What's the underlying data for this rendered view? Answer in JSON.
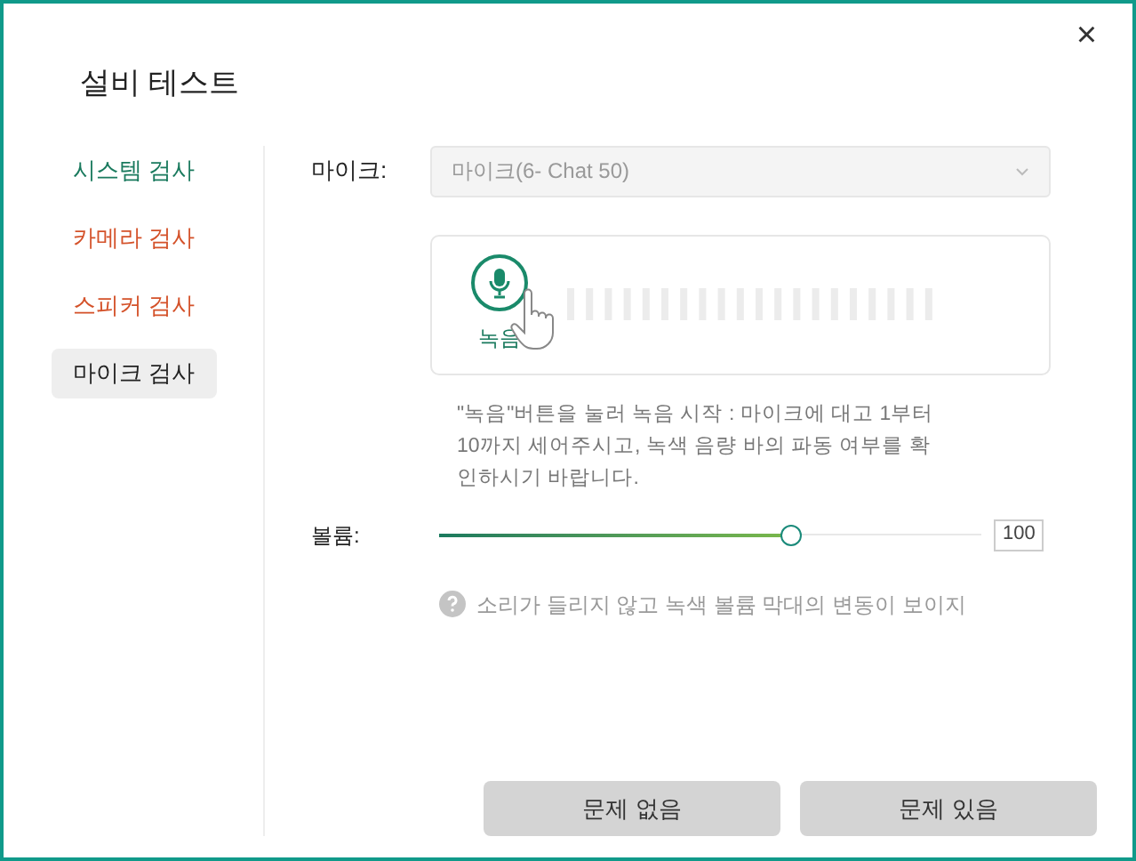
{
  "window": {
    "title": "설비 테스트",
    "close": "×"
  },
  "sidebar": {
    "items": [
      {
        "label": "시스템 검사",
        "selected": false,
        "color": "#1a7a5e"
      },
      {
        "label": "카메라 검사",
        "selected": false,
        "color": "#d4522a"
      },
      {
        "label": "스피커 검사",
        "selected": false,
        "color": "#d4522a"
      },
      {
        "label": "마이크 검사",
        "selected": true,
        "color": "#222222"
      }
    ]
  },
  "microphone": {
    "label": "마이크:",
    "value": "마이크(6- Chat 50)",
    "disabled": true
  },
  "recorder": {
    "button_label": "녹음"
  },
  "instructions": "\"녹음\"버튼을 눌러 녹음 시작 : 마이크에 대고 1부터 10까지 세어주시고, 녹색 음량 바의 파동 여부를 확인하시기 바랍니다.",
  "volume": {
    "label": "볼륨:",
    "level": 0.65,
    "reading": "100"
  },
  "hint": "소리가 들리지 않고 녹색 볼륨 막대의 변동이 보이지",
  "buttons": [
    "문제 없음",
    "문제 있음"
  ]
}
